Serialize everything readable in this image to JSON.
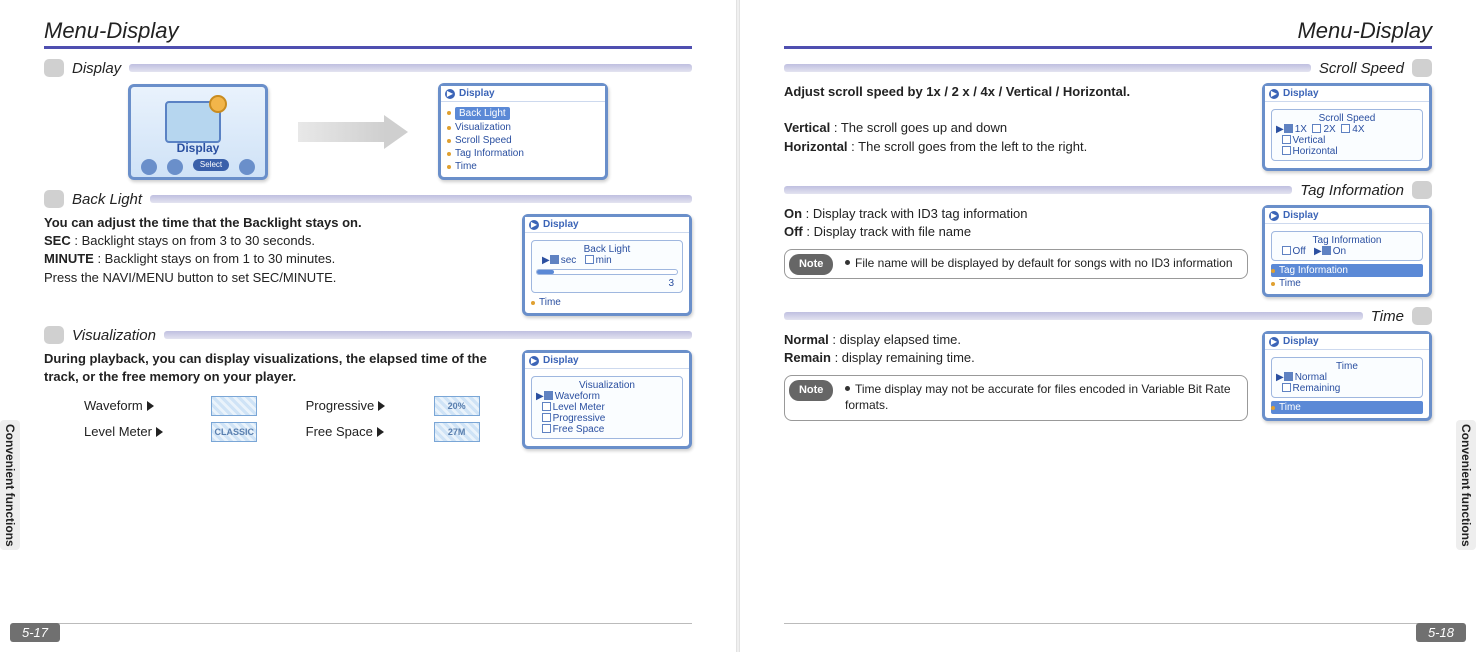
{
  "common": {
    "side_tab": "Convenient functions",
    "note_label": "Note",
    "device_header": "Display",
    "hero_select": "Select"
  },
  "left": {
    "title": "Menu-Display",
    "page_num": "5-17",
    "display": {
      "heading": "Display",
      "hero_label": "Display",
      "menu_items": [
        "Back Light",
        "Visualization",
        "Scroll Speed",
        "Tag Information",
        "Time"
      ]
    },
    "backlight": {
      "heading": "Back Light",
      "lead": "You can adjust the time that the Backlight stays on.",
      "line_sec_b": "SEC",
      "line_sec": " : Backlight stays on from 3 to 30 seconds.",
      "line_min_b": "MINUTE",
      "line_min": " : Backlight stays on from 1 to 30 minutes.",
      "line_navi": "Press the NAVI/MENU button to set SEC/MINUTE.",
      "panel_title": "Back Light",
      "panel_sec": "sec",
      "panel_min": "min",
      "panel_val": "3",
      "panel_footer": "Time"
    },
    "visualization": {
      "heading": "Visualization",
      "lead": "During playback, you can display visualizations, the elapsed time of the track, or the free memory on your player.",
      "labels": {
        "waveform": "Waveform",
        "level": "Level Meter",
        "progressive": "Progressive",
        "free": "Free Space"
      },
      "swatch_level": "CLASSIC",
      "swatch_prog": "20%",
      "swatch_free": "27M",
      "panel_title": "Visualization",
      "panel_items": [
        "Waveform",
        "Level Meter",
        "Progressive",
        "Free Space"
      ]
    }
  },
  "right": {
    "title": "Menu-Display",
    "page_num": "5-18",
    "scroll": {
      "heading": "Scroll Speed",
      "lead": "Adjust scroll speed by 1x / 2 x / 4x / Vertical / Horizontal.",
      "vert_b": "Vertical",
      "vert": " : The scroll goes up and down",
      "horz_b": "Horizontal",
      "horz": " : The scroll goes from the left to the right.",
      "panel_title": "Scroll Speed",
      "opt1": "1X",
      "opt2": "2X",
      "opt3": "4X",
      "opt_v": "Vertical",
      "opt_h": "Horizontal"
    },
    "tag": {
      "heading": "Tag Information",
      "on_b": "On",
      "on": " : Display track with ID3 tag information",
      "off_b": "Off",
      "off": " : Display track with file name",
      "note": "File name will be displayed by default for songs with no ID3 information",
      "panel_title": "Tag Information",
      "opt_off": "Off",
      "opt_on": "On",
      "row_below": "Tag Information",
      "row_time": "Time"
    },
    "time": {
      "heading": "Time",
      "normal_b": "Normal",
      "normal": " : display elapsed time.",
      "remain_b": "Remain",
      "remain": " : display remaining time.",
      "note": "Time display may not be accurate for files encoded in Variable Bit Rate formats.",
      "panel_title": "Time",
      "opt_normal": "Normal",
      "opt_remain": "Remaining",
      "row_footer": "Time"
    }
  }
}
